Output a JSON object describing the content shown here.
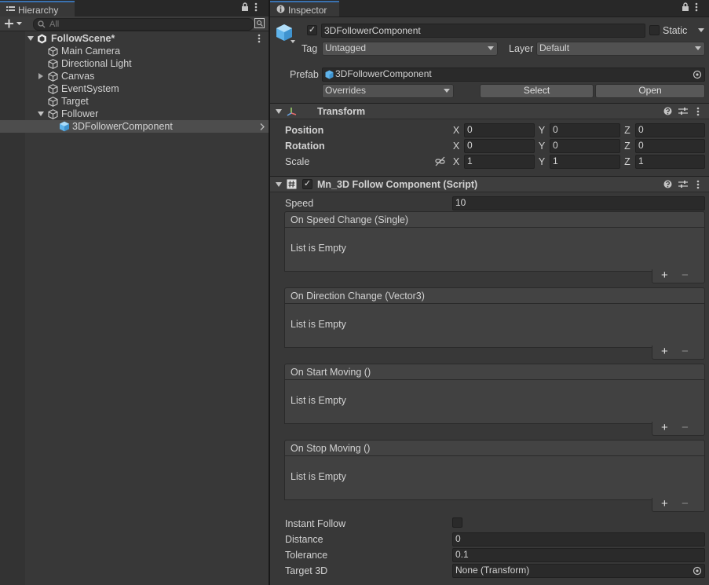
{
  "hierarchy": {
    "tab_label": "Hierarchy",
    "search_placeholder": "All",
    "scene_name": "FollowScene*",
    "items": [
      {
        "label": "Main Camera"
      },
      {
        "label": "Directional Light"
      },
      {
        "label": "Canvas"
      },
      {
        "label": "EventSystem"
      },
      {
        "label": "Target"
      },
      {
        "label": "Follower"
      },
      {
        "label": "3DFollowerComponent"
      }
    ]
  },
  "inspector": {
    "tab_label": "Inspector",
    "object_name": "3DFollowerComponent",
    "static_label": "Static",
    "tag_label": "Tag",
    "tag_value": "Untagged",
    "layer_label": "Layer",
    "layer_value": "Default",
    "prefab_label": "Prefab",
    "prefab_value": "3DFollowerComponent",
    "overrides_label": "Overrides",
    "select_label": "Select",
    "open_label": "Open",
    "transform": {
      "title": "Transform",
      "position_label": "Position",
      "rotation_label": "Rotation",
      "scale_label": "Scale",
      "axis_x": "X",
      "axis_y": "Y",
      "axis_z": "Z",
      "position": [
        "0",
        "0",
        "0"
      ],
      "rotation": [
        "0",
        "0",
        "0"
      ],
      "scale": [
        "1",
        "1",
        "1"
      ]
    },
    "script": {
      "title": "Mn_3D Follow Component (Script)",
      "speed_label": "Speed",
      "speed_value": "10",
      "events": [
        {
          "title": "On Speed Change (Single)",
          "empty_text": "List is Empty"
        },
        {
          "title": "On Direction Change (Vector3)",
          "empty_text": "List is Empty"
        },
        {
          "title": "On Start Moving ()",
          "empty_text": "List is Empty"
        },
        {
          "title": "On Stop Moving ()",
          "empty_text": "List is Empty"
        }
      ],
      "add_symbol": "+",
      "remove_symbol": "−",
      "instant_follow_label": "Instant Follow",
      "distance_label": "Distance",
      "distance_value": "0",
      "tolerance_label": "Tolerance",
      "tolerance_value": "0.1",
      "target_label": "Target 3D",
      "target_value": "None (Transform)"
    }
  },
  "colors": {
    "panel_bg": "#383838",
    "field_bg": "#2a2a2a",
    "selection_bg": "#4d4d4d",
    "accent": "#3a72b0",
    "prefab_icon": "#7ec4f0"
  }
}
